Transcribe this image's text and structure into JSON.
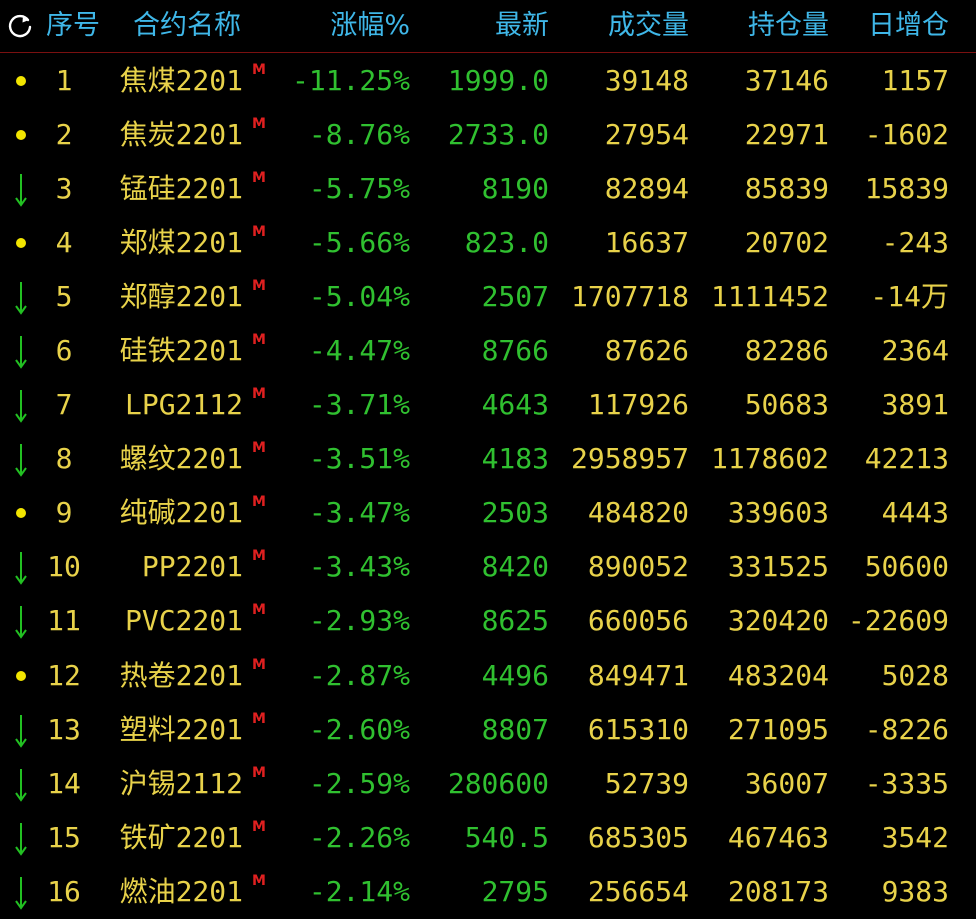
{
  "header": {
    "seq": "序号",
    "name": "合约名称",
    "change_pct": "涨幅%",
    "last": "最新",
    "volume": "成交量",
    "open_interest": "持仓量",
    "daily_oi_change": "日增仓"
  },
  "colors": {
    "header_text": "#3fb7e8",
    "yellow_text": "#e8d24a",
    "green_text": "#30c030",
    "badge_red": "#e02020",
    "dot_yellow": "#f2e500",
    "arrow_green": "#22c022"
  },
  "badge_label": "M",
  "rows": [
    {
      "mark": "dot",
      "seq": "1",
      "name": "焦煤2201",
      "chg": "-11.25%",
      "last": "1999.0",
      "vol": "39148",
      "oi": "37146",
      "doi": "1157"
    },
    {
      "mark": "dot",
      "seq": "2",
      "name": "焦炭2201",
      "chg": "-8.76%",
      "last": "2733.0",
      "vol": "27954",
      "oi": "22971",
      "doi": "-1602"
    },
    {
      "mark": "arrow-down",
      "seq": "3",
      "name": "锰硅2201",
      "chg": "-5.75%",
      "last": "8190",
      "vol": "82894",
      "oi": "85839",
      "doi": "15839"
    },
    {
      "mark": "dot",
      "seq": "4",
      "name": "郑煤2201",
      "chg": "-5.66%",
      "last": "823.0",
      "vol": "16637",
      "oi": "20702",
      "doi": "-243"
    },
    {
      "mark": "arrow-down",
      "seq": "5",
      "name": "郑醇2201",
      "chg": "-5.04%",
      "last": "2507",
      "vol": "1707718",
      "oi": "1111452",
      "doi": "-14万"
    },
    {
      "mark": "arrow-down",
      "seq": "6",
      "name": "硅铁2201",
      "chg": "-4.47%",
      "last": "8766",
      "vol": "87626",
      "oi": "82286",
      "doi": "2364"
    },
    {
      "mark": "arrow-down",
      "seq": "7",
      "name": "LPG2112",
      "chg": "-3.71%",
      "last": "4643",
      "vol": "117926",
      "oi": "50683",
      "doi": "3891"
    },
    {
      "mark": "arrow-down",
      "seq": "8",
      "name": "螺纹2201",
      "chg": "-3.51%",
      "last": "4183",
      "vol": "2958957",
      "oi": "1178602",
      "doi": "42213"
    },
    {
      "mark": "dot",
      "seq": "9",
      "name": "纯碱2201",
      "chg": "-3.47%",
      "last": "2503",
      "vol": "484820",
      "oi": "339603",
      "doi": "4443"
    },
    {
      "mark": "arrow-down",
      "seq": "10",
      "name": "PP2201",
      "chg": "-3.43%",
      "last": "8420",
      "vol": "890052",
      "oi": "331525",
      "doi": "50600"
    },
    {
      "mark": "arrow-down",
      "seq": "11",
      "name": "PVC2201",
      "chg": "-2.93%",
      "last": "8625",
      "vol": "660056",
      "oi": "320420",
      "doi": "-22609"
    },
    {
      "mark": "dot",
      "seq": "12",
      "name": "热卷2201",
      "chg": "-2.87%",
      "last": "4496",
      "vol": "849471",
      "oi": "483204",
      "doi": "5028"
    },
    {
      "mark": "arrow-down",
      "seq": "13",
      "name": "塑料2201",
      "chg": "-2.60%",
      "last": "8807",
      "vol": "615310",
      "oi": "271095",
      "doi": "-8226"
    },
    {
      "mark": "arrow-down",
      "seq": "14",
      "name": "沪锡2112",
      "chg": "-2.59%",
      "last": "280600",
      "vol": "52739",
      "oi": "36007",
      "doi": "-3335"
    },
    {
      "mark": "arrow-down",
      "seq": "15",
      "name": "铁矿2201",
      "chg": "-2.26%",
      "last": "540.5",
      "vol": "685305",
      "oi": "467463",
      "doi": "3542"
    },
    {
      "mark": "arrow-down",
      "seq": "16",
      "name": "燃油2201",
      "chg": "-2.14%",
      "last": "2795",
      "vol": "256654",
      "oi": "208173",
      "doi": "9383"
    }
  ]
}
